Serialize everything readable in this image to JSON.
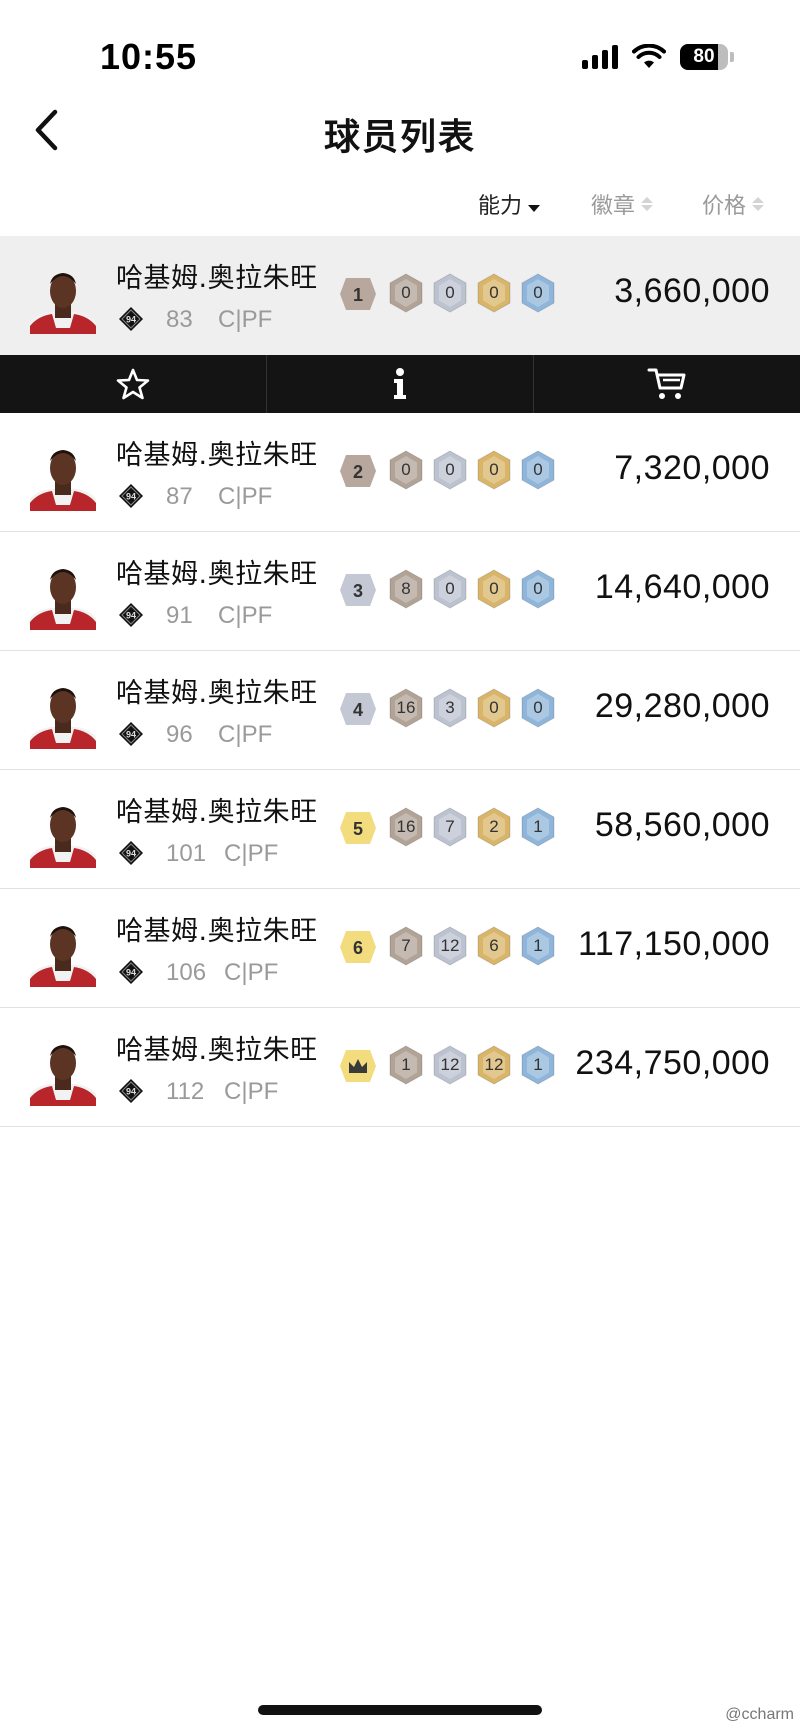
{
  "status_bar": {
    "time": "10:55",
    "battery": "80",
    "battery_level": 0.8
  },
  "header": {
    "title": "球员列表"
  },
  "sort": [
    {
      "label": "能力",
      "active": true
    },
    {
      "label": "徽章",
      "active": false
    },
    {
      "label": "价格",
      "active": false
    }
  ],
  "colors": {
    "tier_bronze": "#b7a79d",
    "tier_silver": "#c3c8d4",
    "tier_gold": "#f3dc7e",
    "badge_bronze": "#b2a397",
    "badge_silver": "#bcc2cf",
    "badge_gold": "#d9b56a",
    "badge_hof": "#8fb6da",
    "action_bar": "#141414"
  },
  "ovr_badge_label": "94",
  "action_bar": {
    "icons": [
      "star-icon",
      "info-icon",
      "cart-icon"
    ]
  },
  "players": [
    {
      "name": "哈基姆.奥拉朱旺",
      "rating": "83",
      "position": "C|PF",
      "tier": "1",
      "tier_color": "bronze",
      "badges": [
        "0",
        "0",
        "0",
        "0"
      ],
      "price": "3,660,000",
      "selected": true
    },
    {
      "name": "哈基姆.奥拉朱旺",
      "rating": "87",
      "position": "C|PF",
      "tier": "2",
      "tier_color": "bronze",
      "badges": [
        "0",
        "0",
        "0",
        "0"
      ],
      "price": "7,320,000",
      "selected": false
    },
    {
      "name": "哈基姆.奥拉朱旺",
      "rating": "91",
      "position": "C|PF",
      "tier": "3",
      "tier_color": "silver",
      "badges": [
        "8",
        "0",
        "0",
        "0"
      ],
      "price": "14,640,000",
      "selected": false
    },
    {
      "name": "哈基姆.奥拉朱旺",
      "rating": "96",
      "position": "C|PF",
      "tier": "4",
      "tier_color": "silver",
      "badges": [
        "16",
        "3",
        "0",
        "0"
      ],
      "price": "29,280,000",
      "selected": false
    },
    {
      "name": "哈基姆.奥拉朱旺",
      "rating": "101",
      "position": "C|PF",
      "tier": "5",
      "tier_color": "gold",
      "badges": [
        "16",
        "7",
        "2",
        "1"
      ],
      "price": "58,560,000",
      "selected": false
    },
    {
      "name": "哈基姆.奥拉朱旺",
      "rating": "106",
      "position": "C|PF",
      "tier": "6",
      "tier_color": "gold",
      "badges": [
        "7",
        "12",
        "6",
        "1"
      ],
      "price": "117,150,000",
      "selected": false
    },
    {
      "name": "哈基姆.奥拉朱旺",
      "rating": "112",
      "position": "C|PF",
      "tier": "crown-icon",
      "tier_color": "gold",
      "badges": [
        "1",
        "12",
        "12",
        "1"
      ],
      "price": "234,750,000",
      "selected": false
    }
  ],
  "watermark": "@ccharm"
}
